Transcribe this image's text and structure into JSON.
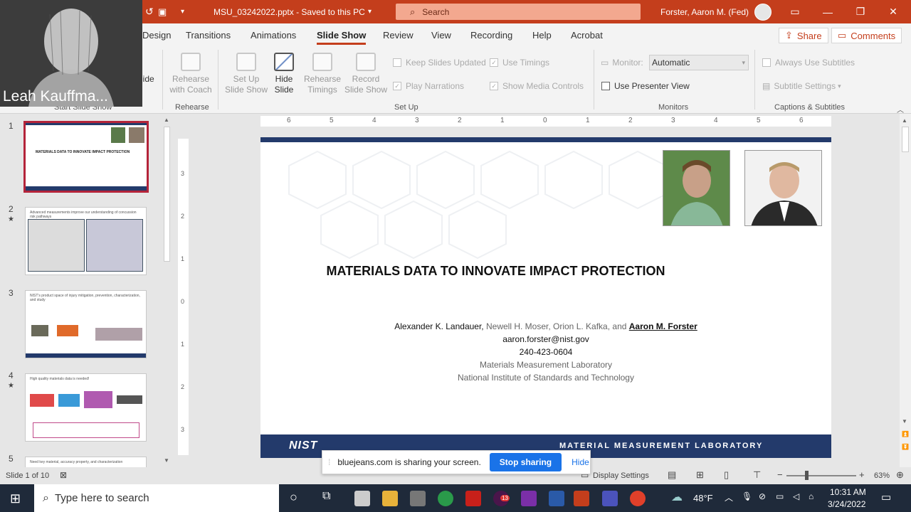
{
  "titlebar": {
    "doc_title": "MSU_03242022.pptx  -  Saved to this PC",
    "search_placeholder": "Search",
    "user_name": "Forster, Aaron M. (Fed)"
  },
  "tabs": [
    "Design",
    "Transitions",
    "Animations",
    "Slide Show",
    "Review",
    "View",
    "Recording",
    "Help",
    "Acrobat"
  ],
  "tab_right": {
    "share": "Share",
    "comments": "Comments"
  },
  "ribbon": {
    "start_slide_fragment": "lide",
    "start_group": "Start Slide Show",
    "rehearse_with_coach": "Rehearse with Coach",
    "rehearse_group": "Rehearse",
    "set_up_slide_show": "Set Up Slide Show",
    "hide_slide": "Hide Slide",
    "rehearse_timings": "Rehearse Timings",
    "record_slide_show": "Record Slide Show",
    "keep_slides_updated": "Keep Slides Updated",
    "use_timings": "Use Timings",
    "play_narrations": "Play Narrations",
    "show_media_controls": "Show Media Controls",
    "setup_group": "Set Up",
    "monitor_label": "Monitor:",
    "monitor_value": "Automatic",
    "use_presenter_view": "Use Presenter View",
    "monitors_group": "Monitors",
    "always_use_subtitles": "Always Use Subtitles",
    "subtitle_settings": "Subtitle Settings",
    "captions_group": "Captions & Subtitles"
  },
  "video": {
    "participant_name": "Leah Kauffma..."
  },
  "thumbnails": [
    {
      "num": "1",
      "title": "MATERIALS DATA TO INNOVATE IMPACT PROTECTION"
    },
    {
      "num": "2",
      "title": "Advanced measurements improve our understanding of concussion risk pathways"
    },
    {
      "num": "3",
      "title": "NIST's product space of injury mitigation, prevention, characterization, and study"
    },
    {
      "num": "4",
      "title": "High quality materials data is needed!"
    },
    {
      "num": "5",
      "title": "Need key material, accuracy property, and characterization"
    }
  ],
  "ruler": {
    "h_ticks": [
      "6",
      "5",
      "4",
      "3",
      "2",
      "1",
      "0",
      "1",
      "2",
      "3",
      "4",
      "5",
      "6"
    ],
    "v_ticks": [
      "3",
      "2",
      "1",
      "0",
      "1",
      "2",
      "3"
    ]
  },
  "slide": {
    "title": "MATERIALS DATA TO INNOVATE IMPACT PROTECTION",
    "author_1": "Alexander K. Landauer,",
    "authors_middle": " Newell H. Moser, Orion L. Kafka, and ",
    "author_last": "Aaron M. Forster",
    "email": "aaron.forster@nist.gov",
    "phone": "240-423-0604",
    "lab": "Materials Measurement Laboratory",
    "institute": "National Institute of Standards and Technology",
    "footer_logo": "NIST",
    "footer_text": "MATERIAL MEASUREMENT LABORATORY"
  },
  "statusbar": {
    "slide_indicator": "Slide 1 of 10",
    "display_settings": "Display Settings",
    "zoom": "63%"
  },
  "share_banner": {
    "message": "bluejeans.com is sharing your screen.",
    "stop": "Stop sharing",
    "hide": "Hide"
  },
  "taskbar": {
    "search": "Type here to search",
    "temp": "48°F",
    "time": "10:31 AM",
    "date": "3/24/2022",
    "mail_badge": "13"
  },
  "colors": {
    "accent": "#c43e1c",
    "nist_blue": "#233a6b",
    "selected_thumb": "#b4243a",
    "share_blue": "#1a73e8"
  }
}
